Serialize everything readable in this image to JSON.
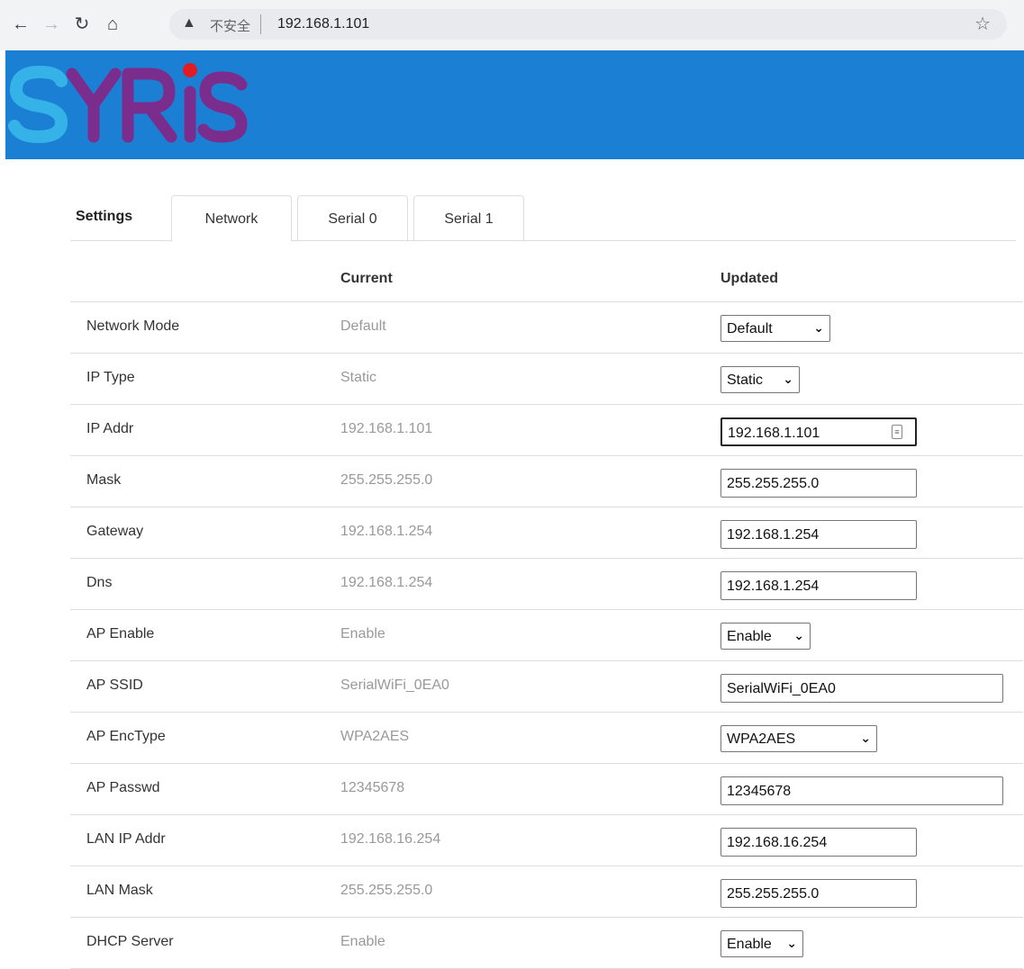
{
  "browser": {
    "insecure_label": "不安全",
    "url": "192.168.1.101"
  },
  "header": {
    "logo_text": "SYRiS",
    "colors": {
      "banner": "#1b7fd4",
      "logo_purple": "#7b2d8e",
      "logo_cyan": "#35b3e8",
      "logo_dot": "#e31b23"
    }
  },
  "tabs": {
    "settings_label": "Settings",
    "items": [
      "Network",
      "Serial 0",
      "Serial 1"
    ],
    "active": "Network"
  },
  "table": {
    "header_current": "Current",
    "header_updated": "Updated",
    "rows": [
      {
        "label": "Network Mode",
        "current": "Default",
        "updated": "Default",
        "control": "select"
      },
      {
        "label": "IP Type",
        "current": "Static",
        "updated": "Static",
        "control": "select"
      },
      {
        "label": "IP Addr",
        "current": "192.168.1.101",
        "updated": "192.168.1.101",
        "control": "input"
      },
      {
        "label": "Mask",
        "current": "255.255.255.0",
        "updated": "255.255.255.0",
        "control": "input"
      },
      {
        "label": "Gateway",
        "current": "192.168.1.254",
        "updated": "192.168.1.254",
        "control": "input"
      },
      {
        "label": "Dns",
        "current": "192.168.1.254",
        "updated": "192.168.1.254",
        "control": "input"
      },
      {
        "label": "AP Enable",
        "current": "Enable",
        "updated": "Enable",
        "control": "select"
      },
      {
        "label": "AP SSID",
        "current": "SerialWiFi_0EA0",
        "updated": "SerialWiFi_0EA0",
        "control": "input"
      },
      {
        "label": "AP EncType",
        "current": "WPA2AES",
        "updated": "WPA2AES",
        "control": "select"
      },
      {
        "label": "AP Passwd",
        "current": "12345678",
        "updated": "12345678",
        "control": "input"
      },
      {
        "label": "LAN IP Addr",
        "current": "192.168.16.254",
        "updated": "192.168.16.254",
        "control": "input"
      },
      {
        "label": "LAN Mask",
        "current": "255.255.255.0",
        "updated": "255.255.255.0",
        "control": "input"
      },
      {
        "label": "DHCP Server",
        "current": "Enable",
        "updated": "Enable",
        "control": "select"
      }
    ]
  }
}
